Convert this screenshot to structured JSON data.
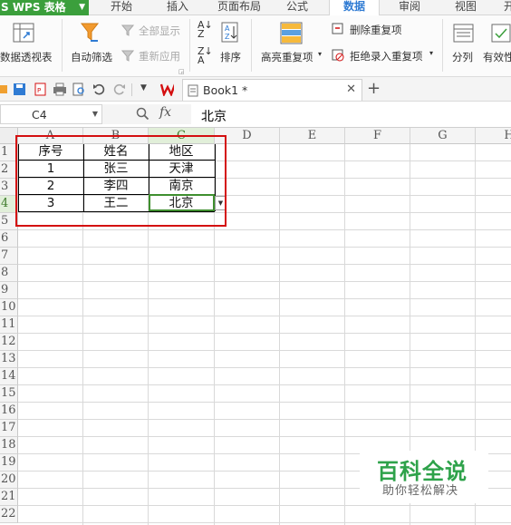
{
  "menubar": {
    "app_label": "S WPS 表格",
    "tabs": [
      "开始",
      "插入",
      "页面布局",
      "公式",
      "数据",
      "审阅",
      "视图",
      "开"
    ],
    "active_tab": "数据"
  },
  "ribbon": {
    "pivot_table": "数据透视表",
    "auto_filter": "自动筛选",
    "show_all": "全部显示",
    "reapply": "重新应用",
    "sort": "排序",
    "highlight_duplicates": "高亮重复项",
    "remove_duplicates": "删除重复项",
    "reject_duplicate_entry": "拒绝录入重复项",
    "split": "分列",
    "validity": "有效性"
  },
  "qat": {
    "document_tab": "Book1 *",
    "add_tab": "+"
  },
  "formula_bar": {
    "cell_ref": "C4",
    "fx": "fx",
    "value": "北京"
  },
  "sheet": {
    "columns": [
      "A",
      "B",
      "C",
      "D",
      "E",
      "F",
      "G",
      "H"
    ],
    "active_column": "C",
    "rows": [
      "1",
      "2",
      "3",
      "4",
      "5",
      "6",
      "7",
      "8",
      "9",
      "10",
      "11",
      "12",
      "13",
      "14",
      "15",
      "16",
      "17",
      "18",
      "19",
      "20",
      "21",
      "22"
    ],
    "active_row": "4",
    "table": {
      "headers": [
        "序号",
        "姓名",
        "地区"
      ],
      "data": [
        [
          "1",
          "张三",
          "天津"
        ],
        [
          "2",
          "李四",
          "南京"
        ],
        [
          "3",
          "王二",
          "北京"
        ]
      ]
    }
  },
  "watermark": {
    "title": "百科全说",
    "subtitle": "助你轻松解决"
  },
  "colors": {
    "accent_green": "#3b9f3c",
    "active_tab_blue": "#2f7bd3",
    "highlight_red": "#d40f10",
    "selection_green": "#3f8f2f"
  }
}
